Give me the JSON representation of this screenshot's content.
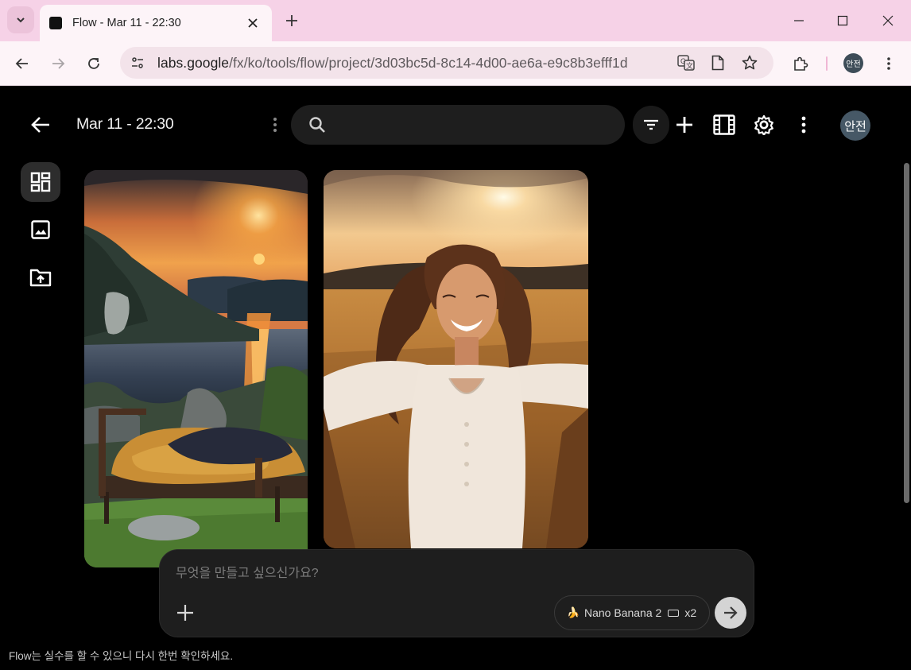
{
  "browser": {
    "tab_title": "Flow - Mar 11 - 22:30",
    "url_domain": "labs.google",
    "url_path": "/fx/ko/tools/flow/project/3d03bc5d-8c14-4d00-ae6a-e9c8b3efff1d",
    "profile_initials": "안전"
  },
  "app": {
    "project_title": "Mar 11 - 22:30",
    "search": {
      "placeholder": "",
      "value": ""
    },
    "avatar_initials": "안전",
    "prompt": {
      "placeholder": "무엇을 만들고 싶으신가요?",
      "model_name": "Nano Banana 2",
      "model_emoji": "🍌",
      "count": "x2"
    },
    "disclaimer": "Flow는 실수를 할 수 있으니 다시 한번 확인하세요.",
    "gallery": [
      {
        "icon": "image-landscape-sunset-lake"
      },
      {
        "icon": "image-woman-wheat-field"
      }
    ]
  },
  "colors": {
    "tabstrip": "#f6d2e7",
    "toolbar": "#fdf4f8",
    "app_bg": "#000000",
    "search_bg": "#1e1e1e"
  }
}
